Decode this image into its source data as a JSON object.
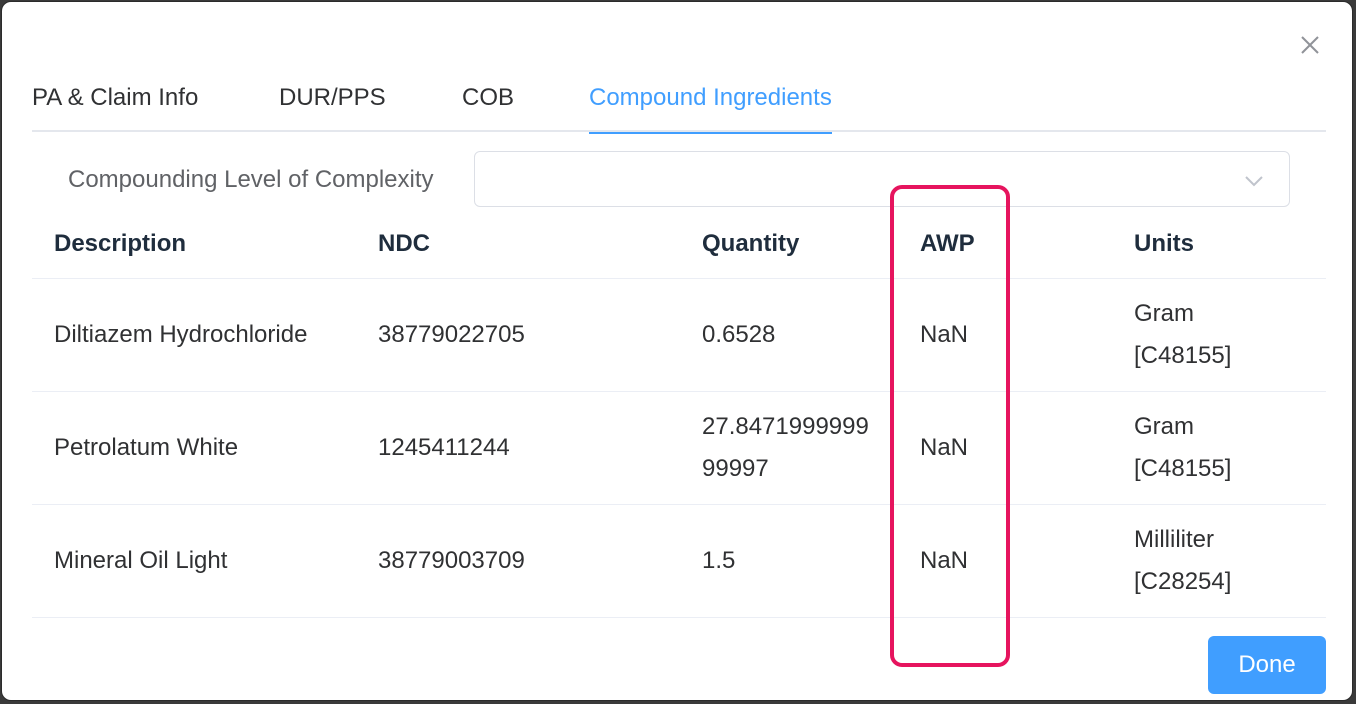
{
  "tabs": [
    {
      "label": "PA & Claim Info",
      "active": false
    },
    {
      "label": "DUR/PPS",
      "active": false
    },
    {
      "label": "COB",
      "active": false
    },
    {
      "label": "Compound Ingredients",
      "active": true
    }
  ],
  "complexity": {
    "label": "Compounding Level of Complexity",
    "value": ""
  },
  "table": {
    "headers": {
      "description": "Description",
      "ndc": "NDC",
      "quantity": "Quantity",
      "awp": "AWP",
      "units": "Units"
    },
    "rows": [
      {
        "description": "Diltiazem Hydrochloride",
        "ndc": "38779022705",
        "quantity": "0.6528",
        "awp": "NaN",
        "units": "Gram [C48155]"
      },
      {
        "description": "Petrolatum White",
        "ndc": "1245411244",
        "quantity": "27.847199999999997",
        "awp": "NaN",
        "units": "Gram [C48155]"
      },
      {
        "description": "Mineral Oil Light",
        "ndc": "38779003709",
        "quantity": "1.5",
        "awp": "NaN",
        "units": "Milliliter [C28254]"
      }
    ]
  },
  "actions": {
    "done_label": "Done"
  },
  "icons": {
    "close": "close-icon",
    "select_arrow": "chevron-down-icon"
  },
  "colors": {
    "accent": "#409eff",
    "highlight": "#e6145e"
  }
}
